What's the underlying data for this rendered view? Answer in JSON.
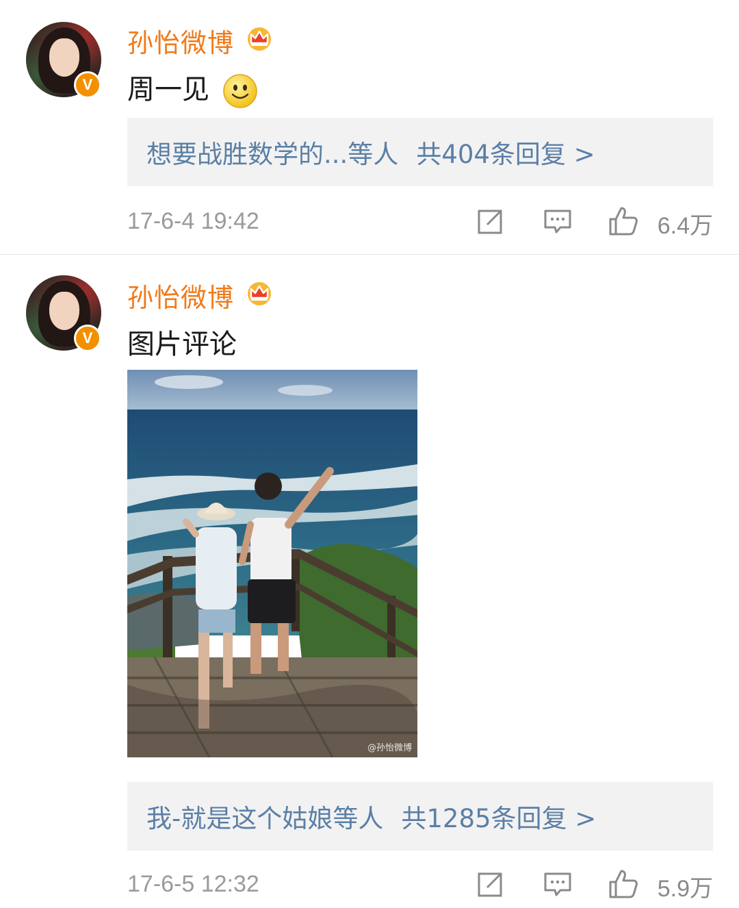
{
  "posts": [
    {
      "username": "孙怡微博",
      "content": "周一见",
      "reply_who": "想要战胜数学的...等人",
      "reply_count": "共404条回复 >",
      "timestamp": "17-6-4 19:42",
      "likes": "6.4万"
    },
    {
      "username": "孙怡微博",
      "content": "图片评论",
      "photo_watermark": "@孙怡微博",
      "reply_who": "我-就是这个姑娘等人",
      "reply_count": "共1285条回复 >",
      "timestamp": "17-6-5 12:32",
      "likes": "5.9万"
    }
  ],
  "icons": {
    "verified": "verified-v-badge",
    "member": "crown-icon",
    "share": "share-icon",
    "comment": "comment-icon",
    "like": "thumbs-up-icon"
  },
  "colors": {
    "username": "#f07a1a",
    "reply_link": "#5b7fa6",
    "meta": "#9a9a9a",
    "reply_bg": "#f2f2f2"
  }
}
